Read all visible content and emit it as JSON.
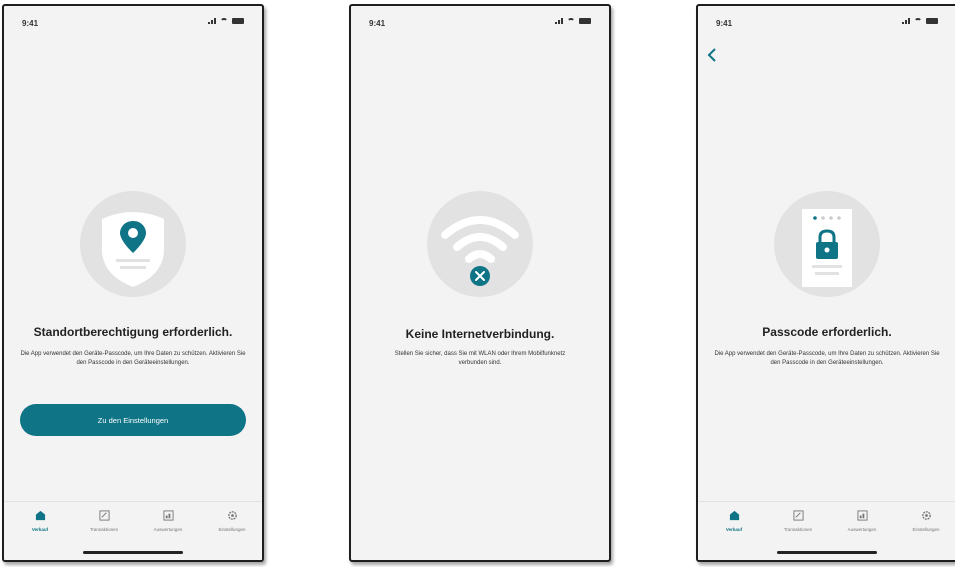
{
  "status_time": "9:41",
  "screens": [
    {
      "title": "Standortberechtigung erforderlich.",
      "description": "Die App verwendet den Geräte-Passcode, um Ihre Daten zu schützen. Aktivieren Sie den Passcode in den Geräteeinstellungen.",
      "button_label": "Zu den Einstellungen"
    },
    {
      "title": "Keine Internetverbindung.",
      "description": "Stellen Sie sicher, dass Sie mit WLAN oder Ihrem Mobilfunknetz verbunden sind."
    },
    {
      "title": "Passcode erforderlich.",
      "description": "Die App verwendet den Geräte-Passcode, um Ihre Daten zu schützen. Aktivieren Sie den Passcode in den Geräteeinstellungen."
    }
  ],
  "tabbar": {
    "items": [
      {
        "label": "Verkauf",
        "icon": "home-icon"
      },
      {
        "label": "Transaktionen",
        "icon": "transactions-icon"
      },
      {
        "label": "Auswertungen",
        "icon": "analytics-icon"
      },
      {
        "label": "Einstellungen",
        "icon": "gear-icon"
      }
    ]
  },
  "colors": {
    "accent": "#0e7486",
    "background": "#f3f3f3",
    "illustration_bg": "#e2e2e2"
  }
}
